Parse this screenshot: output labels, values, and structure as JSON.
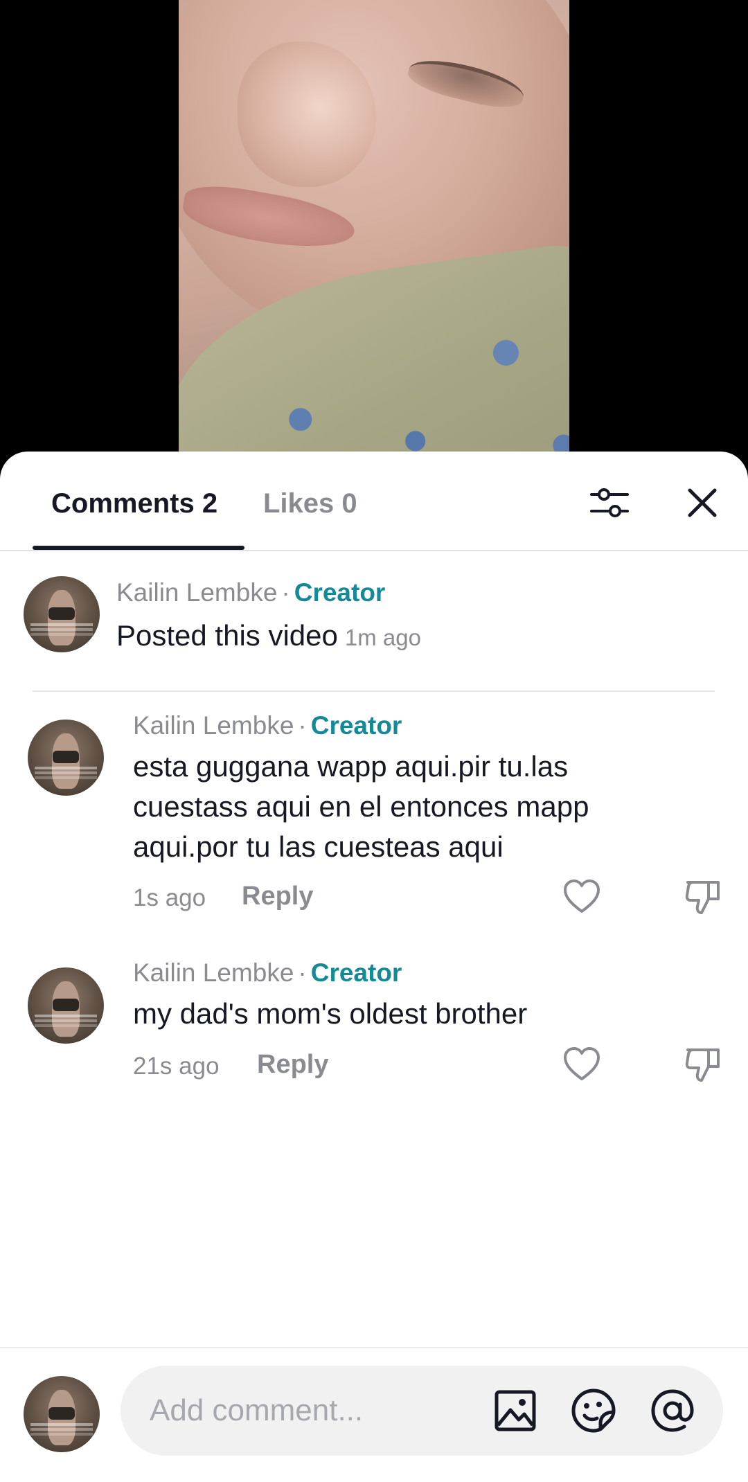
{
  "tabs": {
    "comments_label": "Comments 2",
    "likes_label": "Likes 0"
  },
  "header_icons": [
    "filter-icon",
    "close-icon"
  ],
  "creator_post": {
    "author": "Kailin Lembke",
    "separator": "·",
    "badge": "Creator",
    "text": "Posted this video",
    "time": "1m ago"
  },
  "comments": [
    {
      "author": "Kailin Lembke",
      "separator": "·",
      "badge": "Creator",
      "text": "esta guggana wapp aqui.pir tu.las cuestass aqui en el entonces mapp aqui.por tu las cuesteas aqui",
      "time": "1s ago",
      "reply_label": "Reply"
    },
    {
      "author": "Kailin Lembke",
      "separator": "·",
      "badge": "Creator",
      "text": "my dad's mom's oldest brother",
      "time": "21s ago",
      "reply_label": "Reply"
    }
  ],
  "composer": {
    "placeholder": "Add comment...",
    "icons": [
      "image-icon",
      "emoji-sticker-icon",
      "mention-at-icon"
    ]
  },
  "colors": {
    "creator_badge": "#148a96",
    "primary_text": "#161823",
    "secondary_text": "#8a8b91"
  }
}
